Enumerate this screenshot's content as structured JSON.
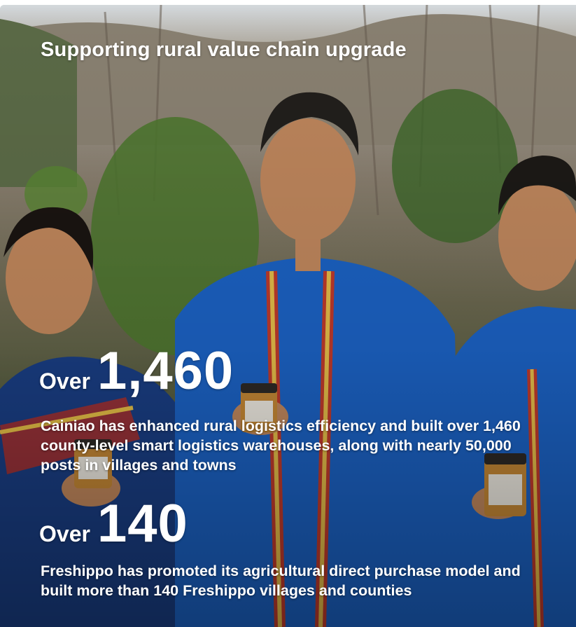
{
  "card": {
    "title": "Supporting rural value chain upgrade",
    "stats": [
      {
        "prefix": "Over",
        "number": "1,460",
        "description": "Cainiao has enhanced rural logistics efficiency and built over 1,460 county-level smart logistics warehouses, along with nearly 50,000 posts in villages and towns"
      },
      {
        "prefix": "Over",
        "number": "140",
        "description": "Freshippo has promoted its agricultural direct purchase model and built more than 140 Freshippo villages and counties"
      }
    ]
  },
  "photo": {
    "subject": "three-people-in-blue-jackets-holding-honey-jars-photo",
    "colors": {
      "jacket_blue": "#1c64c8",
      "foliage_green": "#4d7a2e",
      "text": "#ffffff"
    }
  }
}
